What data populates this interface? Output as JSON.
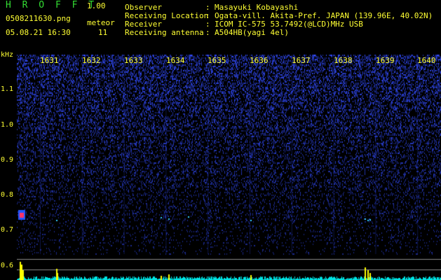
{
  "app": {
    "title": "H R O F F T",
    "version": "1.00"
  },
  "file": {
    "name": "0508211630.png",
    "datetime": "05.08.21 16:30"
  },
  "meteor": {
    "label": "meteor",
    "count": "11"
  },
  "info": [
    {
      "label": "Observer",
      "colon": ":",
      "value": "Masayuki Kobayashi"
    },
    {
      "label": "Receiving Location",
      "colon": ":",
      "value": "Ogata-vill. Akita-Pref. JAPAN (139.96E, 40.02N)"
    },
    {
      "label": "Receiver",
      "colon": ":",
      "value": "ICOM IC-575 53.7492(@LCD)MHz USB"
    },
    {
      "label": "Receiving antenna",
      "colon": ":",
      "value": "A504HB(yagi 4el)"
    }
  ],
  "time_axis": {
    "ticks": [
      "1631",
      "1632",
      "1633",
      "1634",
      "1635",
      "1636",
      "1637",
      "1638",
      "1639",
      "1640"
    ]
  },
  "freq_axis": {
    "unit": "kHz",
    "ticks": [
      "1.1",
      "1.0",
      "0.9",
      "0.8",
      "0.7",
      "0.6"
    ]
  },
  "colors": {
    "yellow": "#ffff33",
    "green": "#33dd33",
    "background": "#000000",
    "spectrogram": "#2a3fc8",
    "meteor_echo": "#ff3366",
    "level_bar": "#ffff00",
    "noise_trace": "#00e5e5"
  }
}
